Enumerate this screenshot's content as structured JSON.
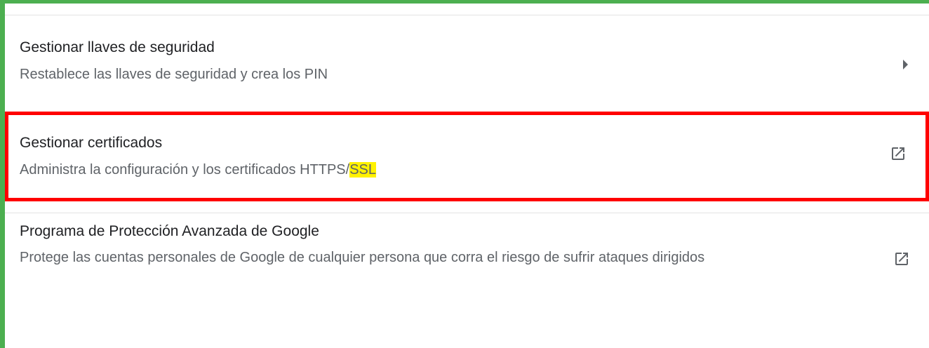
{
  "settings": {
    "items": [
      {
        "title": "Gestionar llaves de seguridad",
        "description": "Restablece las llaves de seguridad y crea los PIN",
        "icon": "chevron-right-icon"
      },
      {
        "title": "Gestionar certificados",
        "description_prefix": "Administra la configuración y los certificados HTTPS/",
        "description_highlight": "SSL",
        "icon": "open-in-new-icon"
      },
      {
        "title": "Programa de Protección Avanzada de Google",
        "description": "Protege las cuentas personales de Google de cualquier persona que corra el riesgo de sufrir ataques dirigidos",
        "icon": "open-in-new-icon"
      }
    ]
  },
  "colors": {
    "frame_border": "#4caf50",
    "highlight_box": "#ff0000",
    "search_highlight": "#fff200",
    "title_text": "#202124",
    "secondary_text": "#5f6368"
  }
}
